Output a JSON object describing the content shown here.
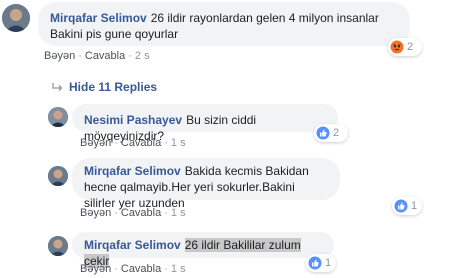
{
  "comments": {
    "top": {
      "author": "Mirqafar Selimov",
      "text": "26 ildir rayonlardan gelen 4 milyon insanlar Bakini pis gune qoyurlar",
      "like_label": "Bəyən",
      "reply_label": "Cavabla",
      "time": "2 s",
      "reaction_count": "2",
      "reaction_type": "angry"
    },
    "hide_replies_label": "Hide 11 Replies",
    "replies": [
      {
        "author": "Nesimi Pashayev",
        "text": "Bu sizin ciddi mövqeyinizdir?",
        "like_label": "Bəyən",
        "reply_label": "Cavabla",
        "time": "1 s",
        "reaction_count": "2",
        "reaction_type": "like"
      },
      {
        "author": "Mirqafar Selimov",
        "text": "Bakida kecmis Bakidan hecne qalmayib.Her yeri sokurler.Bakini silirler yer uzunden",
        "like_label": "Bəyən",
        "reply_label": "Cavabla",
        "time": "1 s",
        "reaction_count": "1",
        "reaction_type": "like"
      },
      {
        "author": "Mirqafar Selimov",
        "text": "26 ildir Bakililar zulum cekir",
        "like_label": "Bəyən",
        "reply_label": "Cavabla",
        "time": "1 s",
        "reaction_count": "1",
        "reaction_type": "like"
      }
    ]
  },
  "colors": {
    "author_link": "#385898",
    "bubble_bg": "#f2f3f5",
    "like_blue": "#5890ff",
    "angry_orange": "#f0742f"
  }
}
